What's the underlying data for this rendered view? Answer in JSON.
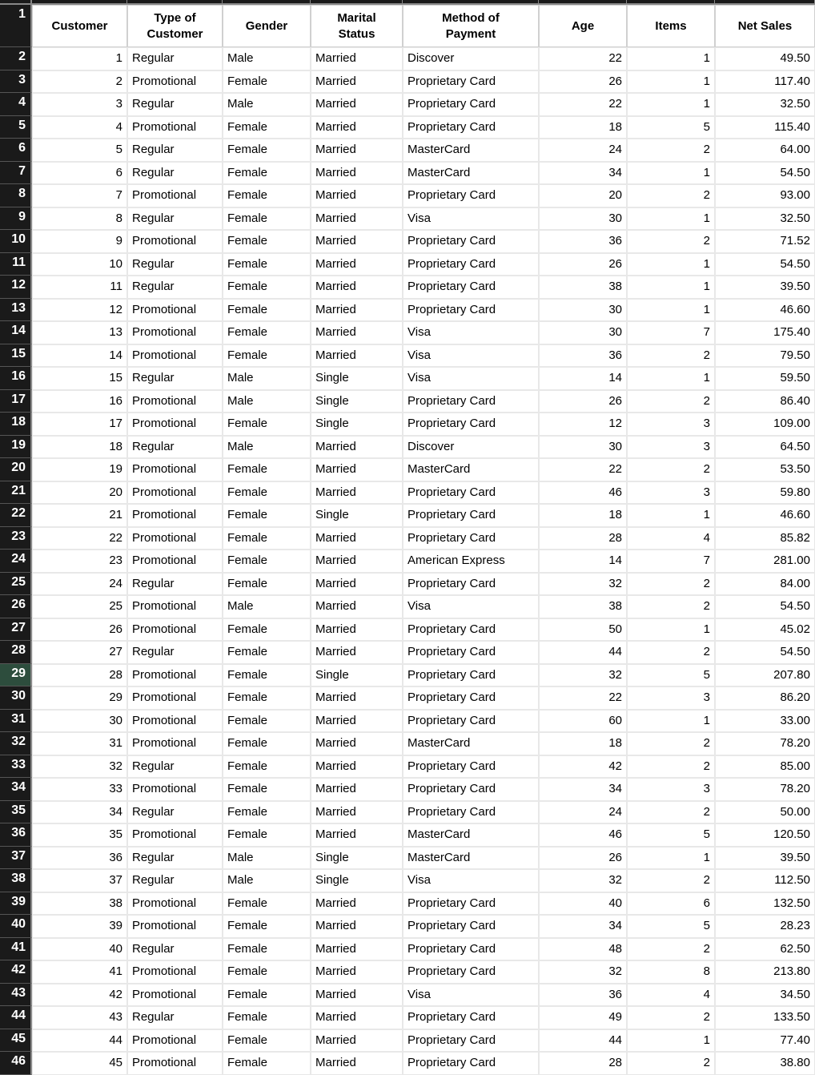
{
  "headers": [
    "Customer",
    "Type of\nCustomer",
    "Gender",
    "Marital\nStatus",
    "Method of\nPayment",
    "Age",
    "Items",
    "Net Sales"
  ],
  "rowNumbers": [
    1,
    2,
    3,
    4,
    5,
    6,
    7,
    8,
    9,
    10,
    11,
    12,
    13,
    14,
    15,
    16,
    17,
    18,
    19,
    20,
    21,
    22,
    23,
    24,
    25,
    26,
    27,
    28,
    29,
    30,
    31,
    32,
    33,
    34,
    35,
    36,
    37,
    38,
    39,
    40,
    41,
    42,
    43,
    44,
    45,
    46
  ],
  "selectedRow": 29,
  "rows": [
    {
      "customer": 1,
      "type": "Regular",
      "gender": "Male",
      "marital": "Married",
      "payment": "Discover",
      "age": 22,
      "items": 1,
      "net": "49.50"
    },
    {
      "customer": 2,
      "type": "Promotional",
      "gender": "Female",
      "marital": "Married",
      "payment": "Proprietary Card",
      "age": 26,
      "items": 1,
      "net": "117.40"
    },
    {
      "customer": 3,
      "type": "Regular",
      "gender": "Male",
      "marital": "Married",
      "payment": "Proprietary Card",
      "age": 22,
      "items": 1,
      "net": "32.50"
    },
    {
      "customer": 4,
      "type": "Promotional",
      "gender": "Female",
      "marital": "Married",
      "payment": "Proprietary Card",
      "age": 18,
      "items": 5,
      "net": "115.40"
    },
    {
      "customer": 5,
      "type": "Regular",
      "gender": "Female",
      "marital": "Married",
      "payment": "MasterCard",
      "age": 24,
      "items": 2,
      "net": "64.00"
    },
    {
      "customer": 6,
      "type": "Regular",
      "gender": "Female",
      "marital": "Married",
      "payment": "MasterCard",
      "age": 34,
      "items": 1,
      "net": "54.50"
    },
    {
      "customer": 7,
      "type": "Promotional",
      "gender": "Female",
      "marital": "Married",
      "payment": "Proprietary Card",
      "age": 20,
      "items": 2,
      "net": "93.00"
    },
    {
      "customer": 8,
      "type": "Regular",
      "gender": "Female",
      "marital": "Married",
      "payment": "Visa",
      "age": 30,
      "items": 1,
      "net": "32.50"
    },
    {
      "customer": 9,
      "type": "Promotional",
      "gender": "Female",
      "marital": "Married",
      "payment": "Proprietary Card",
      "age": 36,
      "items": 2,
      "net": "71.52"
    },
    {
      "customer": 10,
      "type": "Regular",
      "gender": "Female",
      "marital": "Married",
      "payment": "Proprietary Card",
      "age": 26,
      "items": 1,
      "net": "54.50"
    },
    {
      "customer": 11,
      "type": "Regular",
      "gender": "Female",
      "marital": "Married",
      "payment": "Proprietary Card",
      "age": 38,
      "items": 1,
      "net": "39.50"
    },
    {
      "customer": 12,
      "type": "Promotional",
      "gender": "Female",
      "marital": "Married",
      "payment": "Proprietary Card",
      "age": 30,
      "items": 1,
      "net": "46.60"
    },
    {
      "customer": 13,
      "type": "Promotional",
      "gender": "Female",
      "marital": "Married",
      "payment": "Visa",
      "age": 30,
      "items": 7,
      "net": "175.40"
    },
    {
      "customer": 14,
      "type": "Promotional",
      "gender": "Female",
      "marital": "Married",
      "payment": "Visa",
      "age": 36,
      "items": 2,
      "net": "79.50"
    },
    {
      "customer": 15,
      "type": "Regular",
      "gender": "Male",
      "marital": "Single",
      "payment": "Visa",
      "age": 14,
      "items": 1,
      "net": "59.50"
    },
    {
      "customer": 16,
      "type": "Promotional",
      "gender": "Male",
      "marital": "Single",
      "payment": "Proprietary Card",
      "age": 26,
      "items": 2,
      "net": "86.40"
    },
    {
      "customer": 17,
      "type": "Promotional",
      "gender": "Female",
      "marital": "Single",
      "payment": "Proprietary Card",
      "age": 12,
      "items": 3,
      "net": "109.00"
    },
    {
      "customer": 18,
      "type": "Regular",
      "gender": "Male",
      "marital": "Married",
      "payment": "Discover",
      "age": 30,
      "items": 3,
      "net": "64.50"
    },
    {
      "customer": 19,
      "type": "Promotional",
      "gender": "Female",
      "marital": "Married",
      "payment": "MasterCard",
      "age": 22,
      "items": 2,
      "net": "53.50"
    },
    {
      "customer": 20,
      "type": "Promotional",
      "gender": "Female",
      "marital": "Married",
      "payment": "Proprietary Card",
      "age": 46,
      "items": 3,
      "net": "59.80"
    },
    {
      "customer": 21,
      "type": "Promotional",
      "gender": "Female",
      "marital": "Single",
      "payment": "Proprietary Card",
      "age": 18,
      "items": 1,
      "net": "46.60"
    },
    {
      "customer": 22,
      "type": "Promotional",
      "gender": "Female",
      "marital": "Married",
      "payment": "Proprietary Card",
      "age": 28,
      "items": 4,
      "net": "85.82"
    },
    {
      "customer": 23,
      "type": "Promotional",
      "gender": "Female",
      "marital": "Married",
      "payment": "American Express",
      "age": 14,
      "items": 7,
      "net": "281.00"
    },
    {
      "customer": 24,
      "type": "Regular",
      "gender": "Female",
      "marital": "Married",
      "payment": "Proprietary Card",
      "age": 32,
      "items": 2,
      "net": "84.00"
    },
    {
      "customer": 25,
      "type": "Promotional",
      "gender": "Male",
      "marital": "Married",
      "payment": "Visa",
      "age": 38,
      "items": 2,
      "net": "54.50"
    },
    {
      "customer": 26,
      "type": "Promotional",
      "gender": "Female",
      "marital": "Married",
      "payment": "Proprietary Card",
      "age": 50,
      "items": 1,
      "net": "45.02"
    },
    {
      "customer": 27,
      "type": "Regular",
      "gender": "Female",
      "marital": "Married",
      "payment": "Proprietary Card",
      "age": 44,
      "items": 2,
      "net": "54.50"
    },
    {
      "customer": 28,
      "type": "Promotional",
      "gender": "Female",
      "marital": "Single",
      "payment": "Proprietary Card",
      "age": 32,
      "items": 5,
      "net": "207.80"
    },
    {
      "customer": 29,
      "type": "Promotional",
      "gender": "Female",
      "marital": "Married",
      "payment": "Proprietary Card",
      "age": 22,
      "items": 3,
      "net": "86.20"
    },
    {
      "customer": 30,
      "type": "Promotional",
      "gender": "Female",
      "marital": "Married",
      "payment": "Proprietary Card",
      "age": 60,
      "items": 1,
      "net": "33.00"
    },
    {
      "customer": 31,
      "type": "Promotional",
      "gender": "Female",
      "marital": "Married",
      "payment": "MasterCard",
      "age": 18,
      "items": 2,
      "net": "78.20"
    },
    {
      "customer": 32,
      "type": "Regular",
      "gender": "Female",
      "marital": "Married",
      "payment": "Proprietary Card",
      "age": 42,
      "items": 2,
      "net": "85.00"
    },
    {
      "customer": 33,
      "type": "Promotional",
      "gender": "Female",
      "marital": "Married",
      "payment": "Proprietary Card",
      "age": 34,
      "items": 3,
      "net": "78.20"
    },
    {
      "customer": 34,
      "type": "Regular",
      "gender": "Female",
      "marital": "Married",
      "payment": "Proprietary Card",
      "age": 24,
      "items": 2,
      "net": "50.00"
    },
    {
      "customer": 35,
      "type": "Promotional",
      "gender": "Female",
      "marital": "Married",
      "payment": "MasterCard",
      "age": 46,
      "items": 5,
      "net": "120.50"
    },
    {
      "customer": 36,
      "type": "Regular",
      "gender": "Male",
      "marital": "Single",
      "payment": "MasterCard",
      "age": 26,
      "items": 1,
      "net": "39.50"
    },
    {
      "customer": 37,
      "type": "Regular",
      "gender": "Male",
      "marital": "Single",
      "payment": "Visa",
      "age": 32,
      "items": 2,
      "net": "112.50"
    },
    {
      "customer": 38,
      "type": "Promotional",
      "gender": "Female",
      "marital": "Married",
      "payment": "Proprietary Card",
      "age": 40,
      "items": 6,
      "net": "132.50"
    },
    {
      "customer": 39,
      "type": "Promotional",
      "gender": "Female",
      "marital": "Married",
      "payment": "Proprietary Card",
      "age": 34,
      "items": 5,
      "net": "28.23"
    },
    {
      "customer": 40,
      "type": "Regular",
      "gender": "Female",
      "marital": "Married",
      "payment": "Proprietary Card",
      "age": 48,
      "items": 2,
      "net": "62.50"
    },
    {
      "customer": 41,
      "type": "Promotional",
      "gender": "Female",
      "marital": "Married",
      "payment": "Proprietary Card",
      "age": 32,
      "items": 8,
      "net": "213.80"
    },
    {
      "customer": 42,
      "type": "Promotional",
      "gender": "Female",
      "marital": "Married",
      "payment": "Visa",
      "age": 36,
      "items": 4,
      "net": "34.50"
    },
    {
      "customer": 43,
      "type": "Regular",
      "gender": "Female",
      "marital": "Married",
      "payment": "Proprietary Card",
      "age": 49,
      "items": 2,
      "net": "133.50"
    },
    {
      "customer": 44,
      "type": "Promotional",
      "gender": "Female",
      "marital": "Married",
      "payment": "Proprietary Card",
      "age": 44,
      "items": 1,
      "net": "77.40"
    },
    {
      "customer": 45,
      "type": "Promotional",
      "gender": "Female",
      "marital": "Married",
      "payment": "Proprietary Card",
      "age": 28,
      "items": 2,
      "net": "38.80"
    }
  ]
}
